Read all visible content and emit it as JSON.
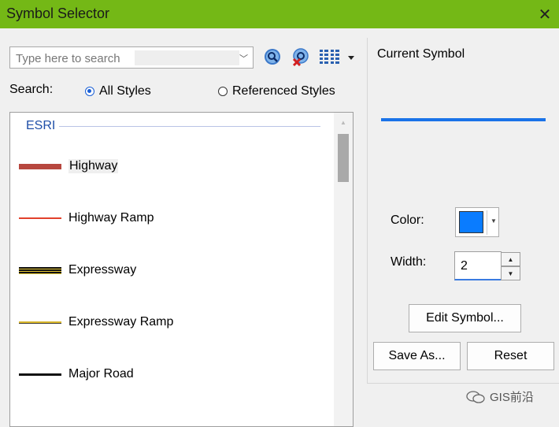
{
  "window": {
    "title": "Symbol Selector",
    "close_glyph": "✕"
  },
  "search": {
    "placeholder": "Type here to search",
    "label": "Search:",
    "options": [
      {
        "label": "All Styles",
        "selected": true
      },
      {
        "label": "Referenced Styles",
        "selected": false
      }
    ]
  },
  "toolbar": {
    "icons": [
      "search-icon",
      "clear-search-icon",
      "view-options-icon",
      "dropdown-arrow-icon"
    ]
  },
  "list": {
    "group": "ESRI",
    "items": [
      {
        "label": "Highway",
        "selected": true
      },
      {
        "label": "Highway Ramp",
        "selected": false
      },
      {
        "label": "Expressway",
        "selected": false
      },
      {
        "label": "Expressway Ramp",
        "selected": false
      },
      {
        "label": "Major Road",
        "selected": false
      }
    ]
  },
  "current": {
    "label": "Current Symbol",
    "color_label": "Color:",
    "color_value": "#0a7cff",
    "width_label": "Width:",
    "width_value": "2"
  },
  "buttons": {
    "edit": "Edit Symbol...",
    "save_as": "Save As...",
    "reset": "Reset"
  },
  "colors": {
    "title_bar": "#74b816",
    "accent": "#1a73e8"
  },
  "watermark": "GIS前沿"
}
